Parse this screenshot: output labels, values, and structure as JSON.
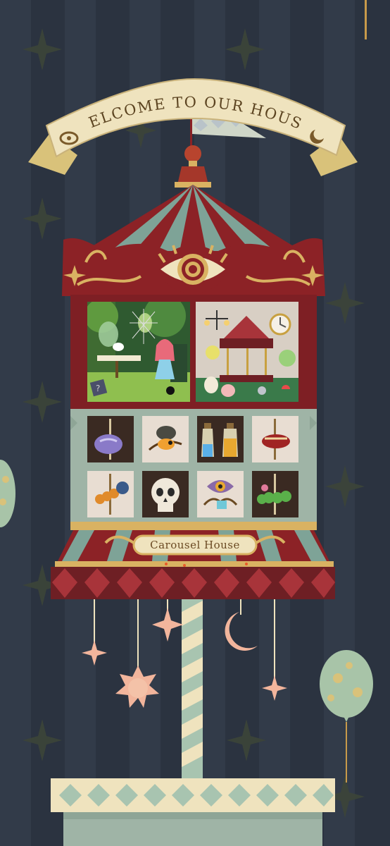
{
  "banner": {
    "text": "WELCOME TO OUR HOUSE"
  },
  "sign": {
    "label": "Carousel House"
  },
  "colors": {
    "background_dark": "#2b3340",
    "background_stripe": "#333c4a",
    "roof_red": "#8c2226",
    "roof_teal": "#7ea397",
    "gold": "#d9b262",
    "cream": "#efe3be",
    "mint": "#a8c4b0",
    "pink": "#f2b59c"
  },
  "rooms": [
    {
      "name": "tea-party-room"
    },
    {
      "name": "carousel-room"
    }
  ],
  "shelf_items": [
    {
      "icon": "purple-beetle-carousel-icon"
    },
    {
      "icon": "orange-bird-branch-icon"
    },
    {
      "icon": "potion-bottles-icon"
    },
    {
      "icon": "red-bug-carousel-icon"
    },
    {
      "icon": "orange-caterpillar-icon"
    },
    {
      "icon": "skull-icon"
    },
    {
      "icon": "eye-flower-icon"
    },
    {
      "icon": "green-caterpillar-carousel-icon"
    }
  ]
}
